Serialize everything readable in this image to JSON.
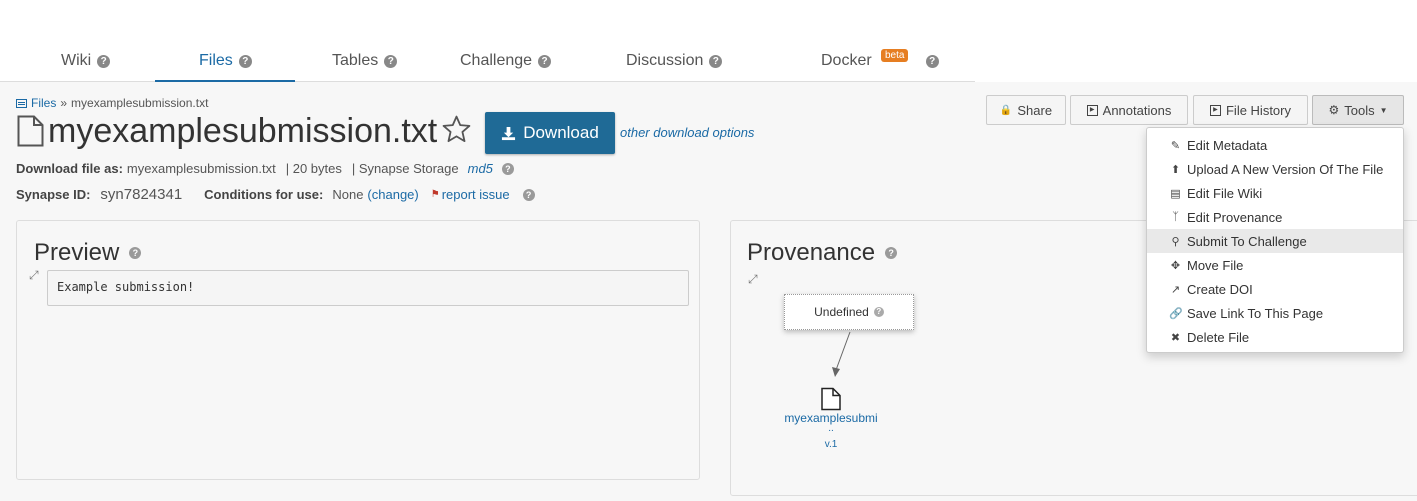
{
  "tabs": [
    {
      "label": "Wiki"
    },
    {
      "label": "Files"
    },
    {
      "label": "Tables"
    },
    {
      "label": "Challenge"
    },
    {
      "label": "Discussion"
    },
    {
      "label": "Docker",
      "badge": "beta"
    }
  ],
  "breadcrumb": {
    "root": "Files",
    "separator": "»",
    "current": "myexamplesubmission.txt"
  },
  "file": {
    "title": "myexamplesubmission.txt",
    "download_label": "Download",
    "other_options": "other download options",
    "download_as_label": "Download file as:",
    "download_as_value": "myexamplesubmission.txt",
    "size": "| 20 bytes",
    "storage": "| Synapse Storage",
    "md5": "md5",
    "synapse_id_label": "Synapse ID:",
    "synapse_id": "syn7824341",
    "conditions_label": "Conditions for use:",
    "conditions_value": "None",
    "change": "(change)",
    "report_issue": "report issue"
  },
  "toolbar": {
    "share": "Share",
    "annotations": "Annotations",
    "file_history": "File History",
    "tools": "Tools"
  },
  "preview": {
    "title": "Preview",
    "content": "Example submission!"
  },
  "provenance": {
    "title": "Provenance",
    "node_label": "Undefined",
    "file_label": "myexamplesubmi",
    "ellipsis": "..",
    "version": "v.1"
  },
  "tools_menu": [
    {
      "label": "Edit Metadata",
      "icon": "edit-icon"
    },
    {
      "label": "Upload A New Version Of The File",
      "icon": "upload-icon"
    },
    {
      "label": "Edit File Wiki",
      "icon": "wiki-icon"
    },
    {
      "label": "Edit Provenance",
      "icon": "provenance-icon"
    },
    {
      "label": "Submit To Challenge",
      "icon": "trophy-icon"
    },
    {
      "label": "Move File",
      "icon": "move-icon"
    },
    {
      "label": "Create DOI",
      "icon": "external-link-icon"
    },
    {
      "label": "Save Link To This Page",
      "icon": "link-icon"
    },
    {
      "label": "Delete File",
      "icon": "delete-icon"
    }
  ],
  "colors": {
    "accent": "#1b6aa5",
    "download_button": "#1f6a96",
    "beta_badge": "#e67e22"
  }
}
